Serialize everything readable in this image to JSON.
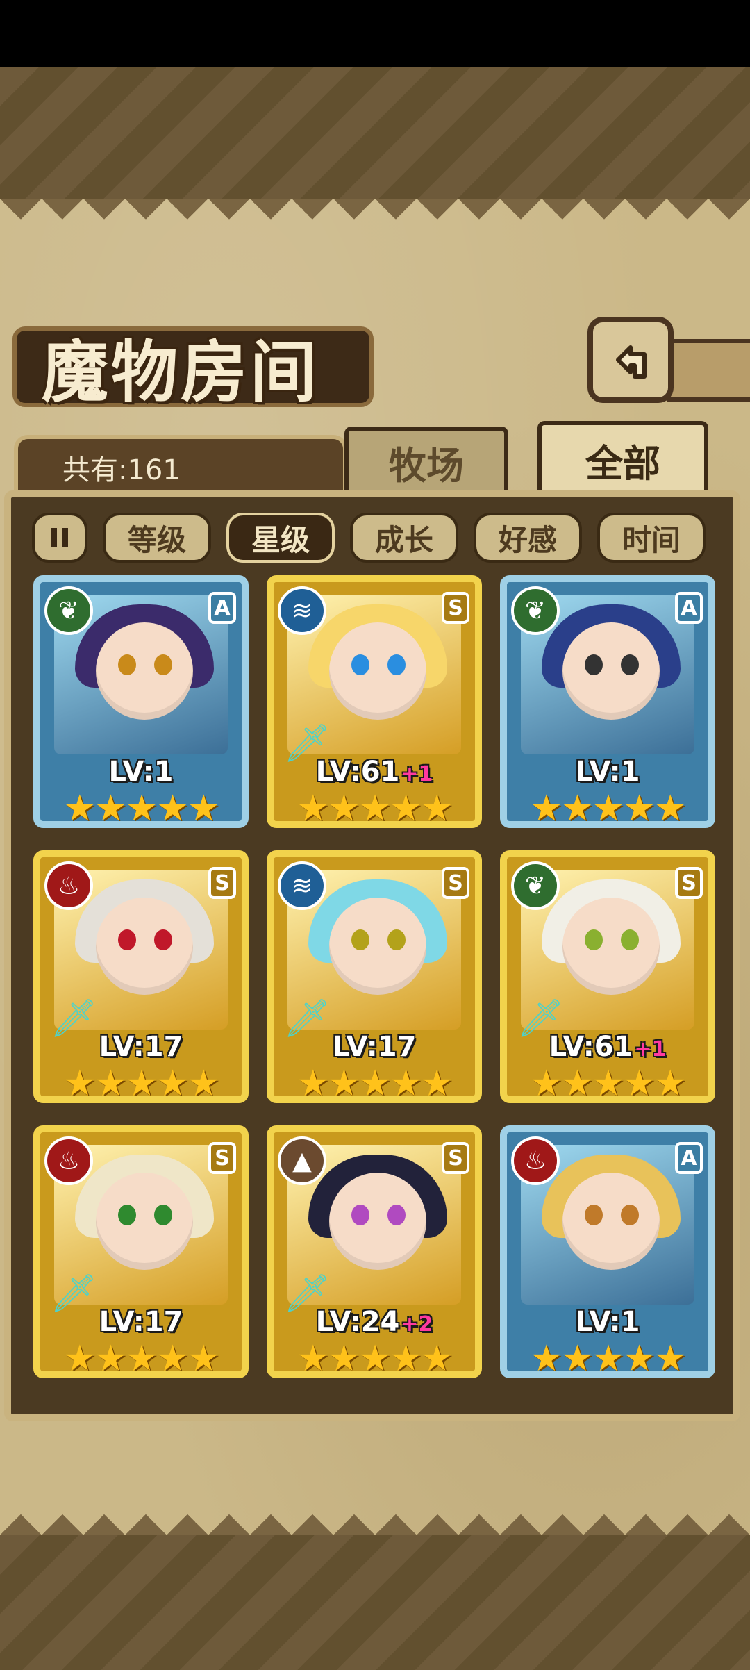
{
  "title": "魔物房间",
  "count_label": "共有:161",
  "tabs": {
    "ranch": "牧场",
    "all": "全部"
  },
  "sort_buttons": [
    "等级",
    "星级",
    "成长",
    "好感",
    "时间"
  ],
  "active_sort": "星级",
  "icons": {
    "pause": "pause-icon",
    "back": "back-arrow-icon"
  },
  "cards": [
    {
      "element": "wood",
      "rank": "A",
      "level": "LV:1",
      "plus": "",
      "stars": "★★★★★",
      "hair": "#3b2b6b",
      "eye": "#c98a1a"
    },
    {
      "element": "water",
      "rank": "S",
      "level": "LV:61",
      "plus": "+1",
      "stars": "★★★★★",
      "hair": "#f7d66a",
      "eye": "#2a8ee0"
    },
    {
      "element": "wood",
      "rank": "A",
      "level": "LV:1",
      "plus": "",
      "stars": "★★★★★",
      "hair": "#2a3f8a",
      "eye": "#333"
    },
    {
      "element": "fire",
      "rank": "S",
      "level": "LV:17",
      "plus": "",
      "stars": "★★★★★",
      "hair": "#e4e0d8",
      "eye": "#c0182a"
    },
    {
      "element": "water",
      "rank": "S",
      "level": "LV:17",
      "plus": "",
      "stars": "★★★★★",
      "hair": "#7fd8e6",
      "eye": "#b3a21a"
    },
    {
      "element": "wood",
      "rank": "S",
      "level": "LV:61",
      "plus": "+1",
      "stars": "★★★★★",
      "hair": "#f1efe6",
      "eye": "#8ab030"
    },
    {
      "element": "fire",
      "rank": "S",
      "level": "LV:17",
      "plus": "",
      "stars": "★★★★★",
      "hair": "#efe6c8",
      "eye": "#2f8a2f"
    },
    {
      "element": "earth",
      "rank": "S",
      "level": "LV:24",
      "plus": "+2",
      "stars": "★★★★★",
      "hair": "#22223a",
      "eye": "#b04ac0"
    },
    {
      "element": "fire",
      "rank": "A",
      "level": "LV:1",
      "plus": "",
      "stars": "★★★★★",
      "hair": "#e8c25a",
      "eye": "#c07a2a"
    }
  ]
}
